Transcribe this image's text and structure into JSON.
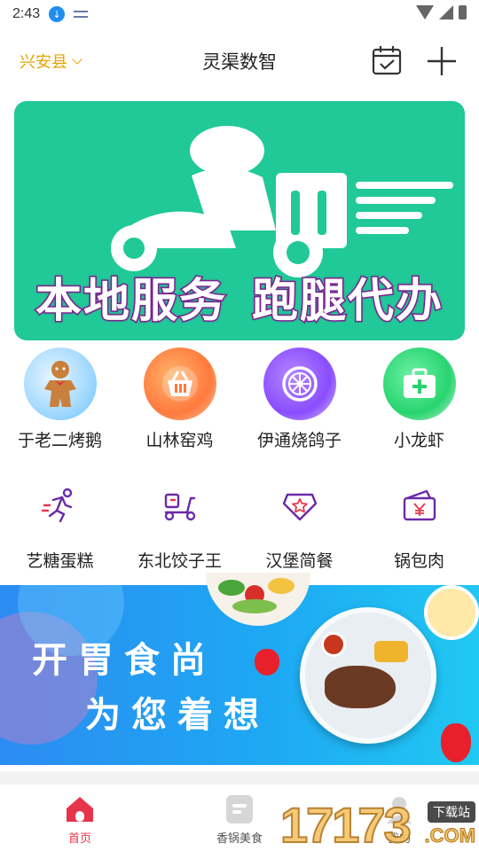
{
  "status_bar": {
    "time": "2:43"
  },
  "header": {
    "location": "兴安县",
    "title": "灵渠数智"
  },
  "hero_banner": {
    "slogan_left": "本地服务",
    "slogan_right": "跑腿代办",
    "bg_color": "#20c997"
  },
  "categories_row1": [
    {
      "label": "于老二烤鹅",
      "icon": "gingerbread-icon"
    },
    {
      "label": "山林窑鸡",
      "icon": "basket-icon"
    },
    {
      "label": "伊通烧鸽子",
      "icon": "lemon-slice-icon"
    },
    {
      "label": "小龙虾",
      "icon": "medical-kit-icon"
    }
  ],
  "categories_row2": [
    {
      "label": "艺糖蛋糕",
      "icon": "runner-icon"
    },
    {
      "label": "东北饺子王",
      "icon": "scooter-icon"
    },
    {
      "label": "汉堡简餐",
      "icon": "star-badge-icon"
    },
    {
      "label": "锅包肉",
      "icon": "wallet-yen-icon"
    }
  ],
  "promo_banner": {
    "line1": "开胃食尚",
    "line2": "为您着想"
  },
  "tabbar": {
    "items": [
      {
        "label": "首页",
        "active": true,
        "icon": "home-icon"
      },
      {
        "label": "香锅美食",
        "active": false,
        "icon": "document-icon"
      },
      {
        "label": "我的",
        "active": false,
        "icon": "user-icon"
      }
    ],
    "active_color": "#e8344a"
  },
  "watermark": {
    "digits": "17173",
    "tag": "下载站",
    "suffix": ".COM"
  }
}
